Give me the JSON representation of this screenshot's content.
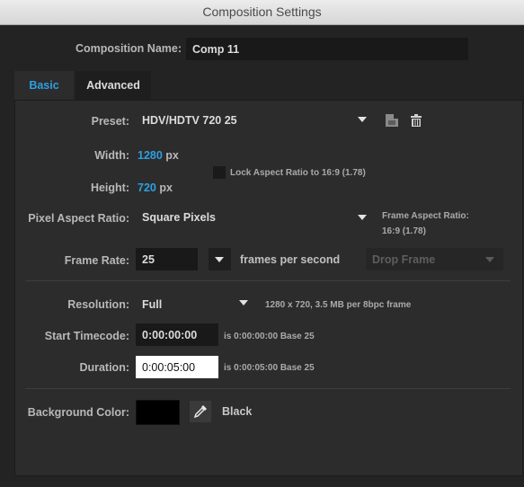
{
  "window": {
    "title": "Composition Settings"
  },
  "comp_name": {
    "label": "Composition Name:",
    "value": "Comp 11"
  },
  "tabs": [
    {
      "label": "Basic",
      "active": true
    },
    {
      "label": "Advanced",
      "active": false
    }
  ],
  "preset": {
    "label": "Preset:",
    "value": "HDV/HDTV 720 25"
  },
  "width": {
    "label": "Width:",
    "value": "1280",
    "unit": "px"
  },
  "height": {
    "label": "Height:",
    "value": "720",
    "unit": "px"
  },
  "lock_aspect": {
    "label": "Lock Aspect Ratio to 16:9 (1.78)",
    "checked": false
  },
  "pixel_aspect": {
    "label": "Pixel Aspect Ratio:",
    "value": "Square Pixels"
  },
  "frame_aspect": {
    "label": "Frame Aspect Ratio:",
    "value": "16:9 (1.78)"
  },
  "frame_rate": {
    "label": "Frame Rate:",
    "value": "25",
    "unit": "frames per second",
    "drop_frame": "Drop Frame"
  },
  "resolution": {
    "label": "Resolution:",
    "value": "Full",
    "info": "1280 x 720, 3.5 MB per 8bpc frame"
  },
  "start_timecode": {
    "label": "Start Timecode:",
    "value": "0:00:00:00",
    "info": "is 0:00:00:00  Base 25"
  },
  "duration": {
    "label": "Duration:",
    "value": "0:00:05:00",
    "info": "is 0:00:05:00  Base 25"
  },
  "background": {
    "label": "Background Color:",
    "color": "#000000",
    "name": "Black"
  },
  "icons": {
    "save_preset": "save-preset-icon",
    "delete_preset": "trash-icon",
    "eyedropper": "eyedropper-icon"
  },
  "colors": {
    "accent": "#2f9fe0",
    "background": "#232323",
    "panel": "#2c2c2c"
  }
}
